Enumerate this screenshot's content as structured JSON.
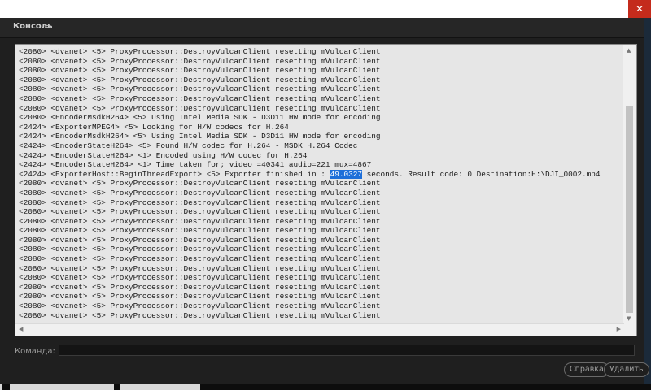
{
  "window": {
    "close_glyph": "✕"
  },
  "panel": {
    "title": "Консоль",
    "menu_glyph": "≡"
  },
  "console": {
    "lines": [
      "<2080> <dvanet> <5> ProxyProcessor::DestroyVulcanClient resetting mVulcanClient",
      "<2080> <dvanet> <5> ProxyProcessor::DestroyVulcanClient resetting mVulcanClient",
      "<2080> <dvanet> <5> ProxyProcessor::DestroyVulcanClient resetting mVulcanClient",
      "<2080> <dvanet> <5> ProxyProcessor::DestroyVulcanClient resetting mVulcanClient",
      "<2080> <dvanet> <5> ProxyProcessor::DestroyVulcanClient resetting mVulcanClient",
      "<2080> <dvanet> <5> ProxyProcessor::DestroyVulcanClient resetting mVulcanClient",
      "<2080> <dvanet> <5> ProxyProcessor::DestroyVulcanClient resetting mVulcanClient",
      "<2080> <EncoderMsdkH264> <5> Using Intel Media SDK - D3D11 HW mode for encoding",
      "<2424> <ExporterMPEG4> <5> Looking for H/W codecs for H.264",
      "<2424> <EncoderMsdkH264> <5> Using Intel Media SDK - D3D11 HW mode for encoding",
      "<2424> <EncoderStateH264> <5> Found H/W codec for H.264 - MSDK H.264 Codec",
      "<2424> <EncoderStateH264> <1> Encoded using H/W codec for H.264",
      "<2424> <EncoderStateH264> <1> Time taken for; video =40341 audio=221 mux=4867"
    ],
    "export_line": {
      "prefix": "<2424> <ExporterHost::BeginThreadExport> <5> Exporter finished in : ",
      "highlight": "49.0327",
      "suffix": " seconds. Result code: 0 Destination:H:\\DJI_0002.mp4"
    },
    "trailing_lines": [
      "<2080> <dvanet> <5> ProxyProcessor::DestroyVulcanClient resetting mVulcanClient",
      "<2080> <dvanet> <5> ProxyProcessor::DestroyVulcanClient resetting mVulcanClient",
      "<2080> <dvanet> <5> ProxyProcessor::DestroyVulcanClient resetting mVulcanClient",
      "<2080> <dvanet> <5> ProxyProcessor::DestroyVulcanClient resetting mVulcanClient",
      "<2080> <dvanet> <5> ProxyProcessor::DestroyVulcanClient resetting mVulcanClient",
      "<2080> <dvanet> <5> ProxyProcessor::DestroyVulcanClient resetting mVulcanClient",
      "<2080> <dvanet> <5> ProxyProcessor::DestroyVulcanClient resetting mVulcanClient",
      "<2080> <dvanet> <5> ProxyProcessor::DestroyVulcanClient resetting mVulcanClient",
      "<2080> <dvanet> <5> ProxyProcessor::DestroyVulcanClient resetting mVulcanClient",
      "<2080> <dvanet> <5> ProxyProcessor::DestroyVulcanClient resetting mVulcanClient",
      "<2080> <dvanet> <5> ProxyProcessor::DestroyVulcanClient resetting mVulcanClient",
      "<2080> <dvanet> <5> ProxyProcessor::DestroyVulcanClient resetting mVulcanClient",
      "<2080> <dvanet> <5> ProxyProcessor::DestroyVulcanClient resetting mVulcanClient",
      "<2080> <dvanet> <5> ProxyProcessor::DestroyVulcanClient resetting mVulcanClient",
      "<2080> <dvanet> <5> ProxyProcessor::DestroyVulcanClient resetting mVulcanClient"
    ]
  },
  "command": {
    "label": "Команда:",
    "value": ""
  },
  "buttons": {
    "help": "Справка",
    "delete": "Удалить"
  },
  "colors": {
    "highlight": "#1e6fd9",
    "close": "#c42b1c",
    "console_bg": "#e6e6e6",
    "panel_bg": "#1f1f1f"
  }
}
